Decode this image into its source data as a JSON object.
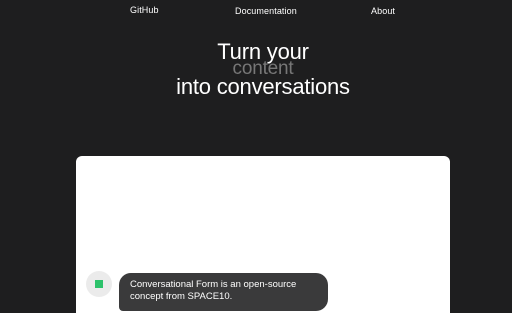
{
  "nav": {
    "github": "GitHub",
    "documentation": "Documentation",
    "about": "About"
  },
  "hero": {
    "line1": "Turn your",
    "rotating_word": "content",
    "line2": "into conversations"
  },
  "demo": {
    "bot_message": "Conversational Form is an open-source concept from SPACE10."
  },
  "colors": {
    "background": "#1e1e1f",
    "card": "#ffffff",
    "bubble": "#3a3a3b",
    "avatar_accent": "#2dc26b",
    "muted_text": "#777777"
  }
}
